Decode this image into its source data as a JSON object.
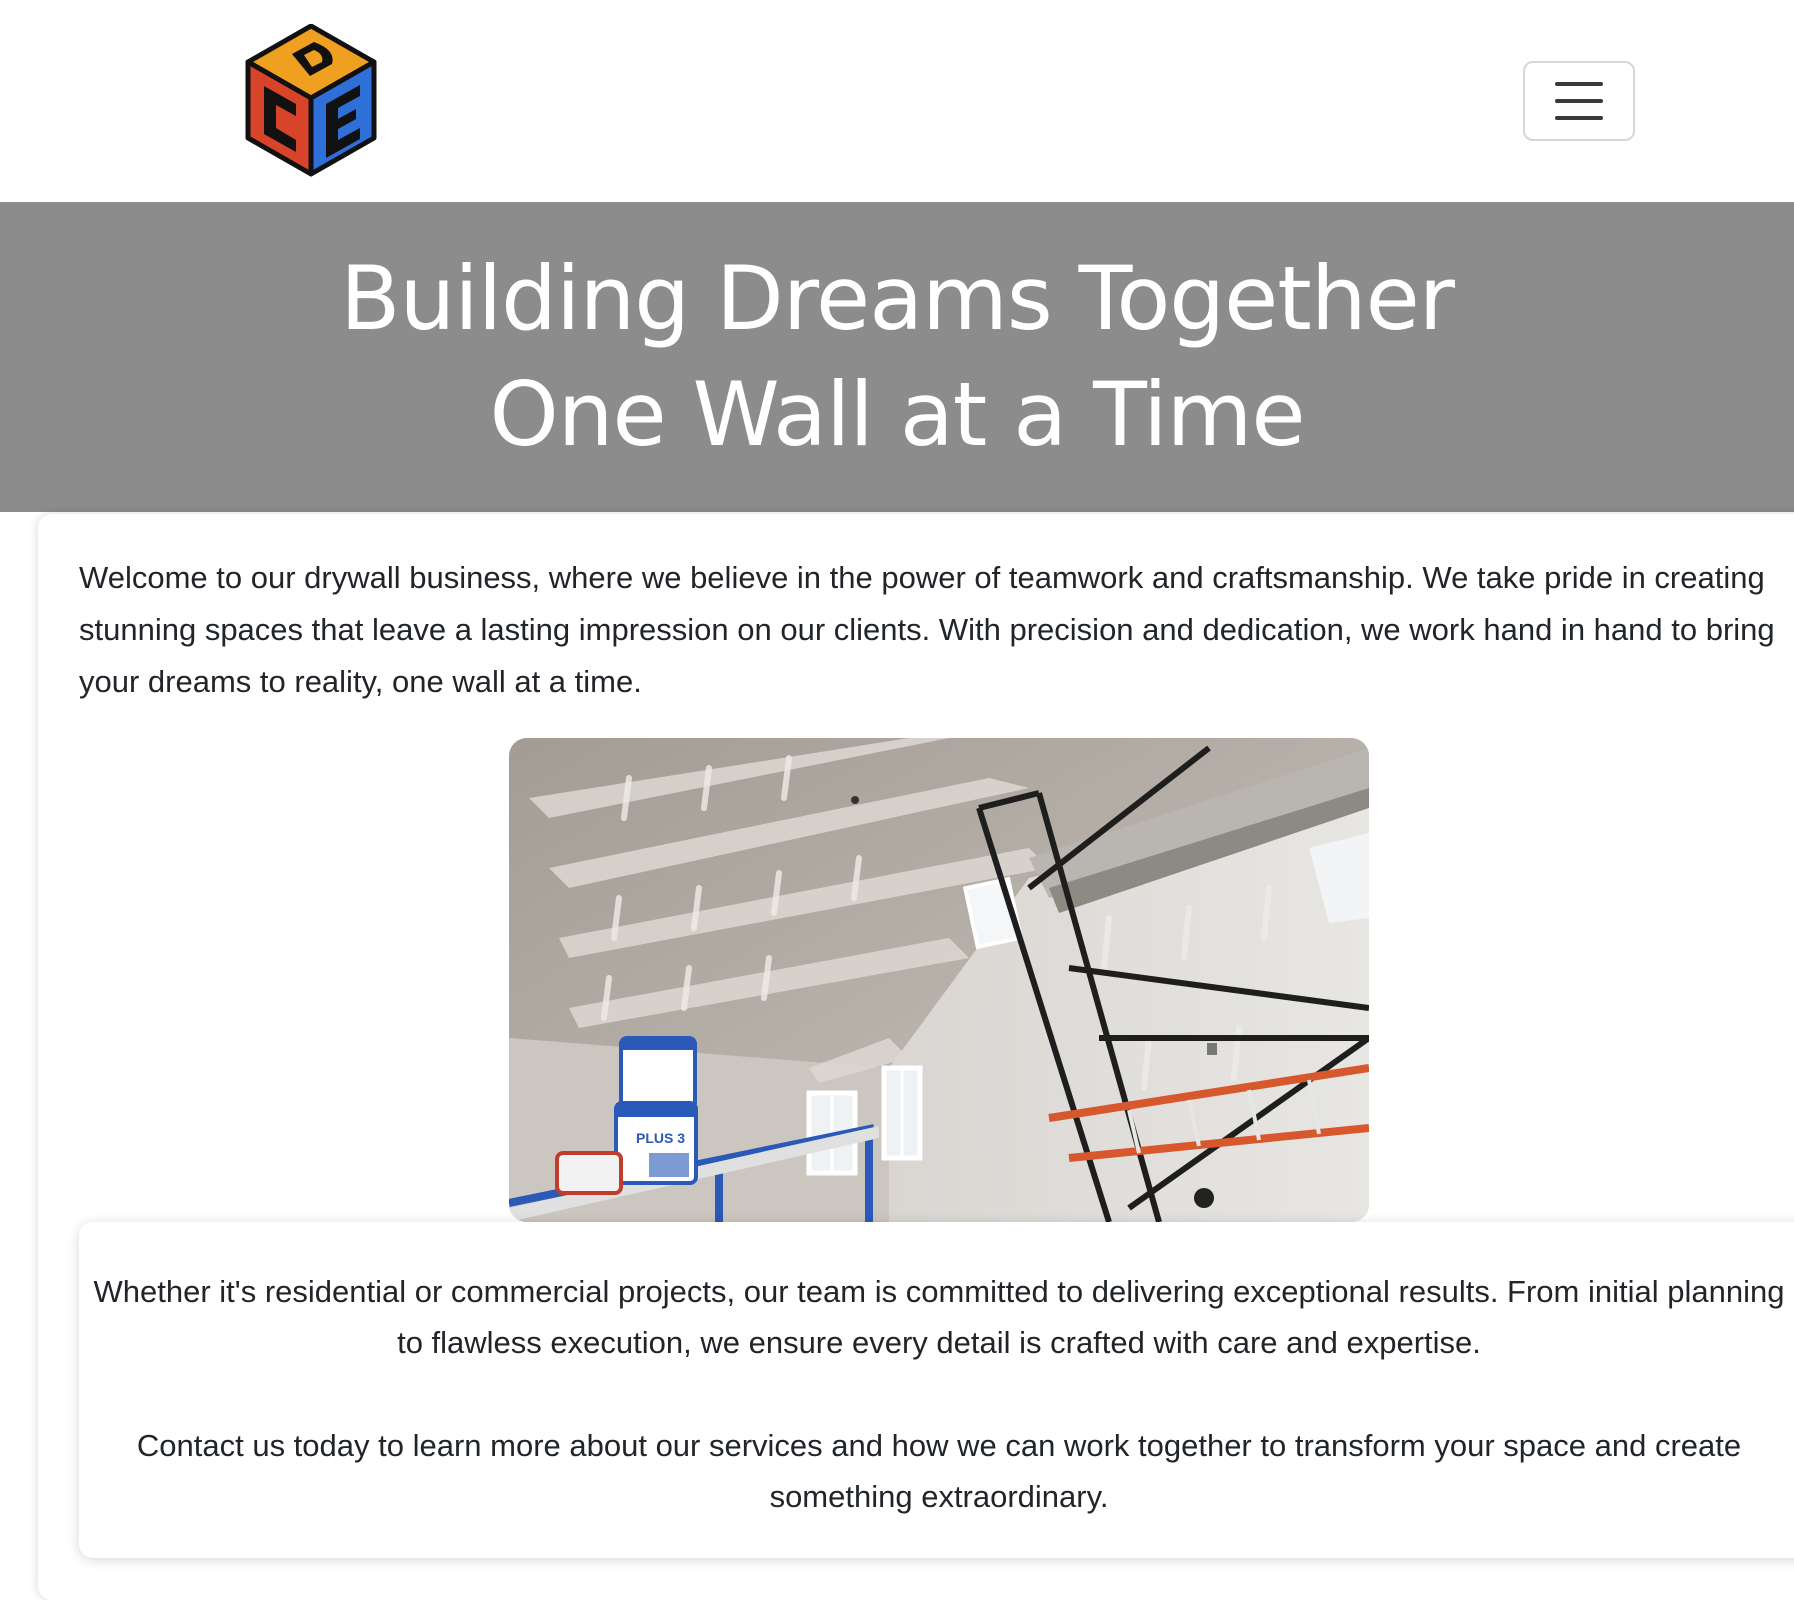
{
  "navbar": {
    "logo": {
      "name": "company-logo",
      "letters": [
        "D",
        "C",
        "E"
      ],
      "colors": {
        "top": "#f0a020",
        "left": "#d8442a",
        "right": "#2e6fd8",
        "outline": "#111111"
      }
    },
    "menu_toggle": {
      "icon": "hamburger-menu-icon"
    }
  },
  "hero": {
    "line1": "Building Dreams Together",
    "line2": "One Wall at a Time",
    "background": "#8c8c8c"
  },
  "main": {
    "intro": "Welcome to our drywall business, where we believe in the power of teamwork and craftsmanship. We take pride in creating stunning spaces that leave a lasting impression on our clients. With precision and dedication, we work hand in hand to bring your dreams to reality, one wall at a time.",
    "photo": {
      "name": "drywall-interior-photo",
      "bucket_label": "PLUS 3"
    },
    "card": {
      "paragraph1": "Whether it's residential or commercial projects, our team is committed to delivering exceptional results. From initial planning to flawless execution, we ensure every detail is crafted with care and expertise.",
      "paragraph2": "Contact us today to learn more about our services and how we can work together to transform your space and create something extraordinary."
    }
  }
}
